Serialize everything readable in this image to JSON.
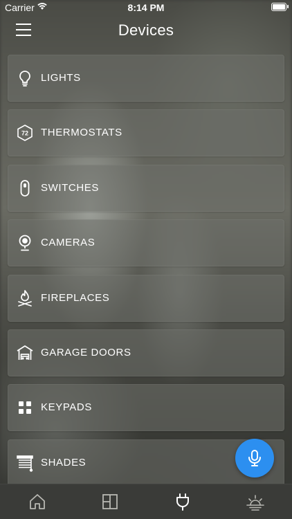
{
  "status_bar": {
    "carrier": "Carrier",
    "time": "8:14 PM"
  },
  "header": {
    "title": "Devices",
    "menu_icon": "hamburger-icon"
  },
  "devices": [
    {
      "label": "LIGHTS",
      "icon": "lightbulb-icon"
    },
    {
      "label": "THERMOSTATS",
      "icon": "thermostat-icon",
      "icon_text": "72"
    },
    {
      "label": "SWITCHES",
      "icon": "switch-icon"
    },
    {
      "label": "CAMERAS",
      "icon": "camera-icon"
    },
    {
      "label": "FIREPLACES",
      "icon": "fireplace-icon"
    },
    {
      "label": "GARAGE DOORS",
      "icon": "garage-icon"
    },
    {
      "label": "KEYPADS",
      "icon": "keypad-icon"
    },
    {
      "label": "SHADES",
      "icon": "shades-icon"
    }
  ],
  "fab": {
    "icon": "microphone-icon",
    "color": "#2c8ff0"
  },
  "tab_bar": [
    {
      "icon": "home-icon",
      "active": false
    },
    {
      "icon": "rooms-icon",
      "active": false
    },
    {
      "icon": "plug-icon",
      "active": true
    },
    {
      "icon": "scenes-icon",
      "active": false
    }
  ],
  "colors": {
    "active_tab": "#ffffff",
    "inactive_tab": "#b8b8b2"
  }
}
